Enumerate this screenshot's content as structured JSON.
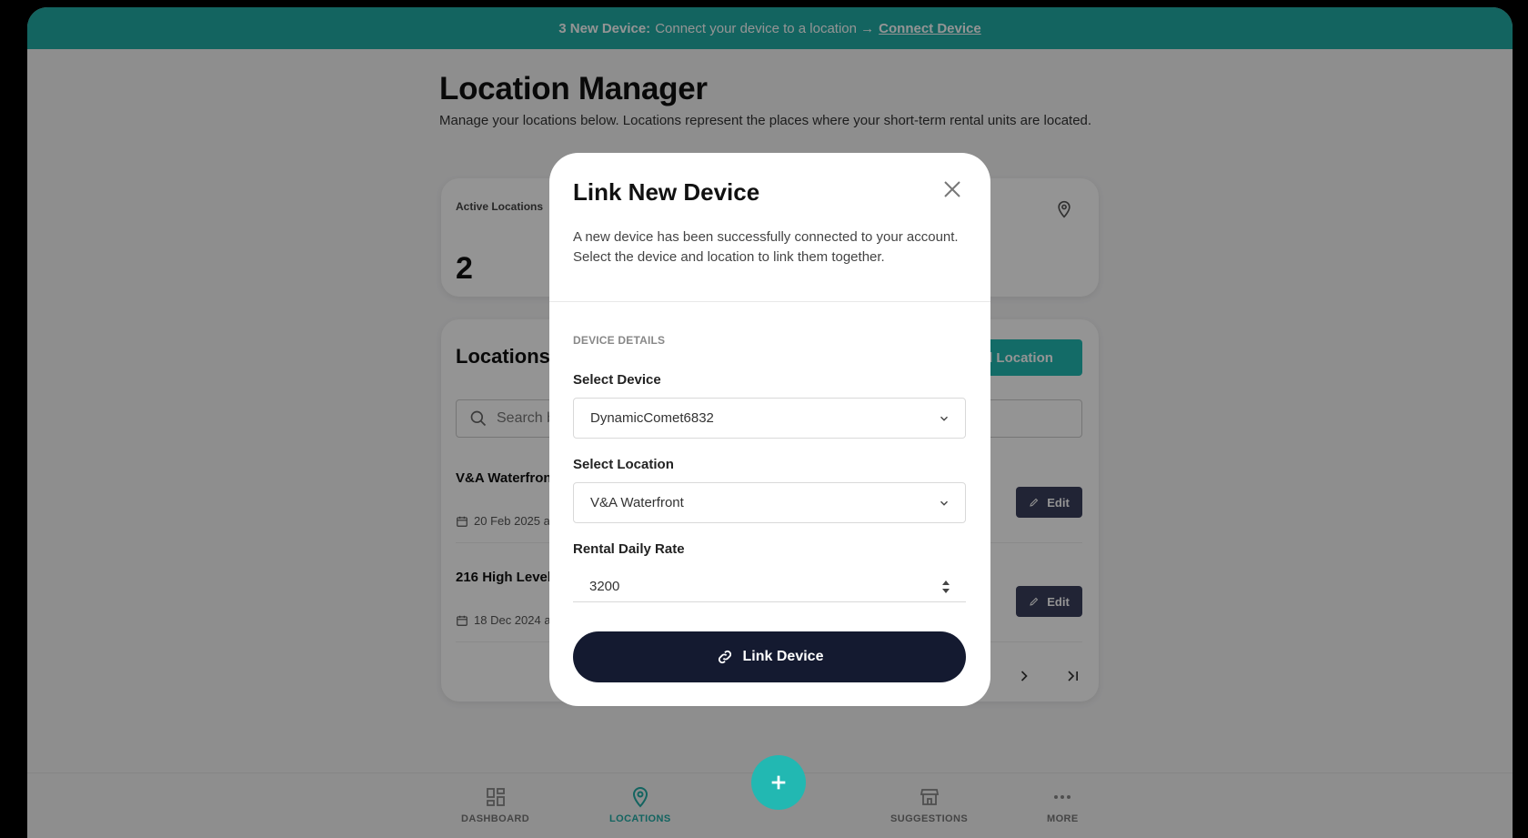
{
  "banner": {
    "count_label": "3 New Device:",
    "message": "Connect your device to a location →",
    "link_label": "Connect Device"
  },
  "page": {
    "title": "Location Manager",
    "description": "Manage your locations below. Locations represent the places where your short-term rental units are located."
  },
  "stats": {
    "label": "Active Locations",
    "value": "2"
  },
  "locations_card": {
    "title": "Locations",
    "add_label": "Add Location",
    "search_placeholder": "Search b",
    "rows": [
      {
        "name": "V&A Waterfron",
        "date": "20 Feb 2025 a",
        "edit_label": "Edit"
      },
      {
        "name": "216 High Level",
        "date": "18 Dec 2024 a",
        "edit_label": "Edit"
      }
    ]
  },
  "bottom_nav": {
    "items": [
      {
        "label": "DASHBOARD",
        "icon": "dashboard-icon"
      },
      {
        "label": "LOCATIONS",
        "icon": "location-pin-icon"
      },
      {
        "label": "SUGGESTIONS",
        "icon": "store-icon"
      },
      {
        "label": "MORE",
        "icon": "more-dots-icon"
      }
    ],
    "fab_icon": "plus-icon"
  },
  "modal": {
    "title": "Link New Device",
    "description": "A new device has been successfully connected to your account. Select the device and location to link them together.",
    "section_label": "DEVICE DETAILS",
    "device_label": "Select Device",
    "device_value": "DynamicComet6832",
    "location_label": "Select Location",
    "location_value": "V&A Waterfront",
    "rate_label": "Rental Daily Rate",
    "rate_value": "3200",
    "submit_label": "Link Device"
  },
  "colors": {
    "accent": "#21aca6",
    "primary_dark": "#141a30",
    "edit_button": "#3a3f5c"
  }
}
